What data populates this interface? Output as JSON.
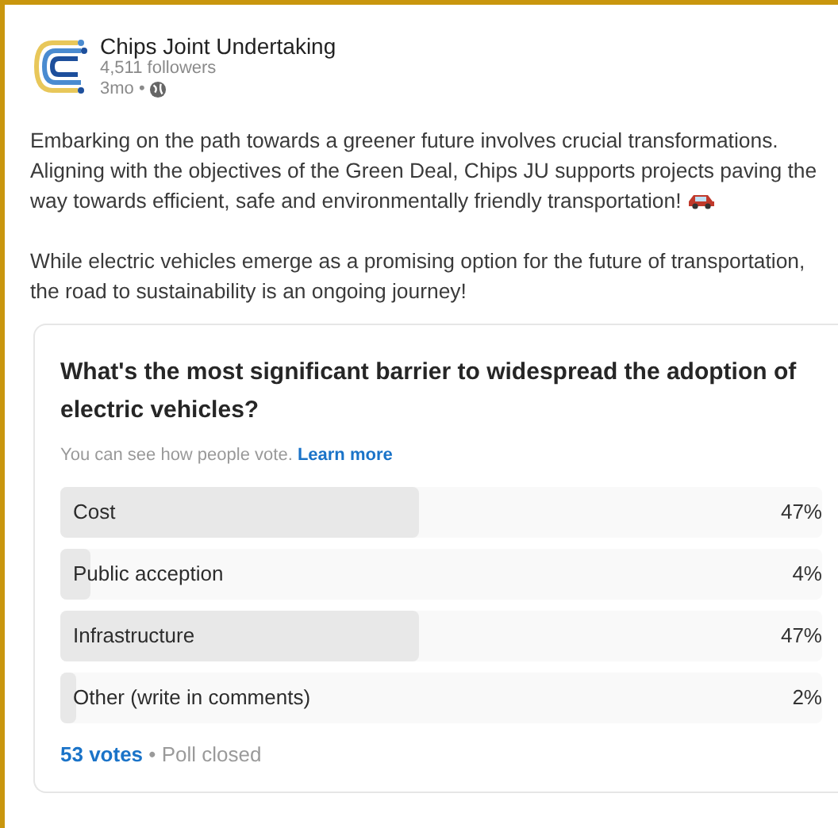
{
  "author": {
    "name": "Chips Joint Undertaking",
    "followers": "4,511 followers",
    "time": "3mo •"
  },
  "post": {
    "paragraphs": [
      "Embarking on the path towards a greener future involves crucial transformations. Aligning with the objectives of the Green Deal, Chips JU supports projects paving the way towards efficient, safe and environmentally friendly transportation!",
      "While electric vehicles emerge as a promising option for the future of transportation, the road to sustainability is an ongoing journey!"
    ]
  },
  "poll": {
    "question": "What's the most significant barrier to widespread the adoption of electric vehicles?",
    "note": "You can see how people vote.",
    "note_link": "Learn more",
    "options": [
      {
        "label": "Cost",
        "level": 0.47,
        "percent": "47%"
      },
      {
        "label": "Public acception",
        "level": 0.04,
        "percent": "4%"
      },
      {
        "label": "Infrastructure",
        "level": 0.47,
        "percent": "47%"
      },
      {
        "label": "Other (write in comments)",
        "level": 0.02,
        "percent": "2%"
      }
    ],
    "votes": "53 votes",
    "status": "• Poll closed"
  }
}
